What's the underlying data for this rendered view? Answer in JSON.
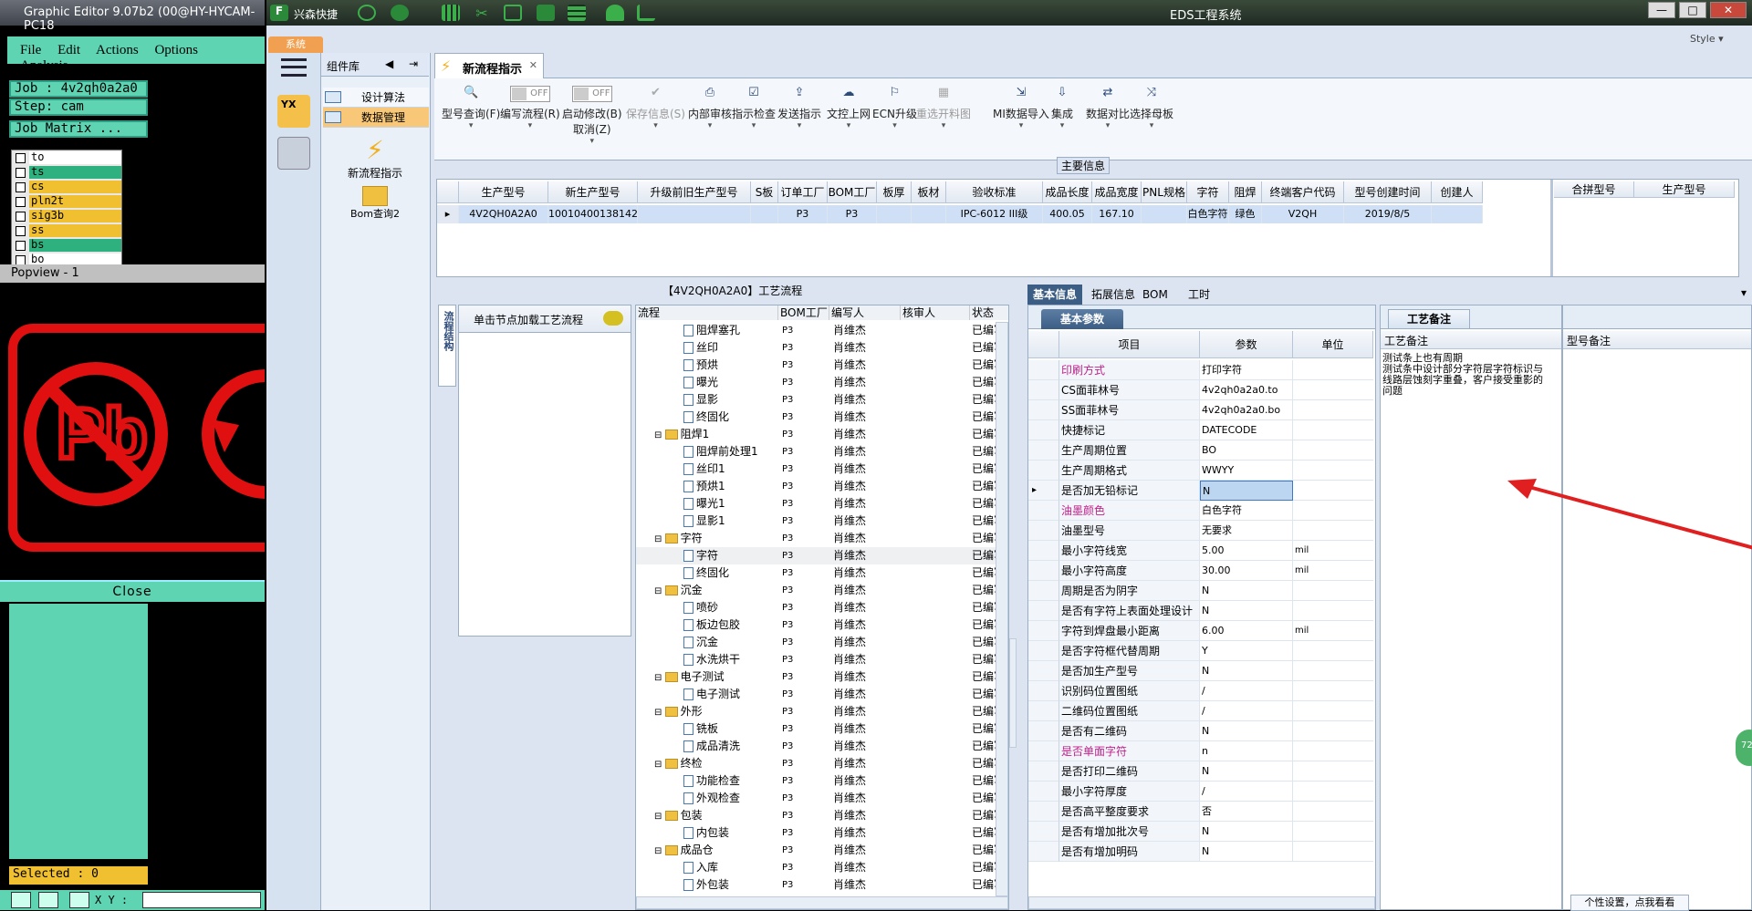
{
  "graphic_editor": {
    "title": "Graphic Editor 9.07b2 (00@HY-HYCAM-PC18",
    "menu": [
      "File",
      "Edit",
      "Actions",
      "Options",
      "Analysis"
    ],
    "job": "Job : 4v2qh0a2a0",
    "step": "Step: cam",
    "job_matrix": "Job Matrix ...",
    "layers": [
      {
        "name": "to",
        "color": "#ffffff"
      },
      {
        "name": "ts",
        "color": "#2fb07f"
      },
      {
        "name": "cs",
        "color": "#f0c030"
      },
      {
        "name": "pln2t",
        "color": "#f0c030"
      },
      {
        "name": "sig3b",
        "color": "#f0c030"
      },
      {
        "name": "ss",
        "color": "#f0c030"
      },
      {
        "name": "bs",
        "color": "#2fb07f"
      },
      {
        "name": "bo",
        "color": "#ffffff"
      }
    ],
    "popview_title": "Popview - 1",
    "close_label": "Close",
    "selected": "Selected : 0",
    "xy_label": "X Y :"
  },
  "eds": {
    "title": "EDS工程系统",
    "app_short": "兴森快捷",
    "system_tab": "系统",
    "side_menu": {
      "header": "组件库",
      "items": [
        "设计算法",
        "数据管理"
      ],
      "launchers": [
        "新流程指示",
        "Bom查询2"
      ]
    },
    "doc_tab": "新流程指示",
    "toolbar": [
      {
        "label": "型号查询(F)",
        "icon": "🔍",
        "enabled": true
      },
      {
        "label": "编写流程(R)",
        "toggle": "OFF",
        "enabled": true
      },
      {
        "label": "启动修改(B)",
        "label2": "取消(Z)",
        "toggle": "OFF",
        "enabled": true
      },
      {
        "label": "保存信息(S)",
        "icon": "✔",
        "enabled": false
      },
      {
        "label": "内部审核",
        "icon": "⎙",
        "enabled": true
      },
      {
        "label": "指示检查",
        "icon": "☑",
        "enabled": true
      },
      {
        "label": "发送指示",
        "icon": "⇪",
        "enabled": true
      },
      {
        "label": "文控上网",
        "icon": "☁",
        "enabled": true
      },
      {
        "label": "ECN升级",
        "icon": "⚐",
        "enabled": true
      },
      {
        "label": "重选开料图",
        "icon": "▦",
        "enabled": false
      },
      {
        "label": "MI数据导入",
        "icon": "⇲",
        "enabled": true
      },
      {
        "label": "集成",
        "icon": "⇩",
        "enabled": true
      },
      {
        "label": "数据对比",
        "icon": "⇄",
        "enabled": true
      },
      {
        "label": "选择母板",
        "icon": "⤨",
        "enabled": true
      }
    ],
    "main_info_label": "主要信息",
    "main_grid": {
      "headers": [
        "生产型号",
        "新生产型号",
        "升级前旧生产型号",
        "S板",
        "订单工厂",
        "BOM工厂",
        "板厚",
        "板材",
        "验收标准",
        "成品长度",
        "成品宽度",
        "PNL规格",
        "字符",
        "阻焊",
        "终端客户代码",
        "型号创建时间",
        "创建人"
      ],
      "row": [
        "4V2QH0A2A0",
        "10010400138142",
        "",
        "",
        "P3",
        "P3",
        "",
        "",
        "IPC-6012 III级",
        "400.05",
        "167.10",
        "",
        "白色字符",
        "绿色",
        "V2QH",
        "2019/8/5",
        ""
      ],
      "side_headers": [
        "合拼型号",
        "生产型号"
      ]
    },
    "process_title": "【4V2QH0A2A0】工艺流程",
    "left_vtab": "流程结构",
    "load_hint": "单击节点加载工艺流程",
    "tree_headers": [
      "流程",
      "BOM工厂",
      "编写人",
      "核审人",
      "状态"
    ],
    "tree_rows": [
      {
        "lvl": 2,
        "name": "阻焊塞孔",
        "f": "P3",
        "w": "肖维杰",
        "s": "已编写"
      },
      {
        "lvl": 2,
        "name": "丝印",
        "f": "P3",
        "w": "肖维杰",
        "s": "已编写"
      },
      {
        "lvl": 2,
        "name": "预烘",
        "f": "P3",
        "w": "肖维杰",
        "s": "已编写"
      },
      {
        "lvl": 2,
        "name": "曝光",
        "f": "P3",
        "w": "肖维杰",
        "s": "已编写"
      },
      {
        "lvl": 2,
        "name": "显影",
        "f": "P3",
        "w": "肖维杰",
        "s": "已编写"
      },
      {
        "lvl": 2,
        "name": "终固化",
        "f": "P3",
        "w": "肖维杰",
        "s": "已编写"
      },
      {
        "lvl": 1,
        "name": "阻焊1",
        "f": "P3",
        "w": "肖维杰",
        "s": "已编写"
      },
      {
        "lvl": 2,
        "name": "阻焊前处理1",
        "f": "P3",
        "w": "肖维杰",
        "s": "已编写"
      },
      {
        "lvl": 2,
        "name": "丝印1",
        "f": "P3",
        "w": "肖维杰",
        "s": "已编写"
      },
      {
        "lvl": 2,
        "name": "预烘1",
        "f": "P3",
        "w": "肖维杰",
        "s": "已编写"
      },
      {
        "lvl": 2,
        "name": "曝光1",
        "f": "P3",
        "w": "肖维杰",
        "s": "已编写"
      },
      {
        "lvl": 2,
        "name": "显影1",
        "f": "P3",
        "w": "肖维杰",
        "s": "已编写"
      },
      {
        "lvl": 1,
        "name": "字符",
        "f": "P3",
        "w": "肖维杰",
        "s": "已编写"
      },
      {
        "lvl": 2,
        "name": "字符",
        "f": "P3",
        "w": "肖维杰",
        "s": "已编写"
      },
      {
        "lvl": 2,
        "name": "终固化",
        "f": "P3",
        "w": "肖维杰",
        "s": "已编写"
      },
      {
        "lvl": 1,
        "name": "沉金",
        "f": "P3",
        "w": "肖维杰",
        "s": "已编写"
      },
      {
        "lvl": 2,
        "name": "喷砂",
        "f": "P3",
        "w": "肖维杰",
        "s": "已编写"
      },
      {
        "lvl": 2,
        "name": "板边包胶",
        "f": "P3",
        "w": "肖维杰",
        "s": "已编写"
      },
      {
        "lvl": 2,
        "name": "沉金",
        "f": "P3",
        "w": "肖维杰",
        "s": "已编写"
      },
      {
        "lvl": 2,
        "name": "水洗烘干",
        "f": "P3",
        "w": "肖维杰",
        "s": "已编写"
      },
      {
        "lvl": 1,
        "name": "电子测试",
        "f": "P3",
        "w": "肖维杰",
        "s": "已编写"
      },
      {
        "lvl": 2,
        "name": "电子测试",
        "f": "P3",
        "w": "肖维杰",
        "s": "已编写"
      },
      {
        "lvl": 1,
        "name": "外形",
        "f": "P3",
        "w": "肖维杰",
        "s": "已编写"
      },
      {
        "lvl": 2,
        "name": "铣板",
        "f": "P3",
        "w": "肖维杰",
        "s": "已编写"
      },
      {
        "lvl": 2,
        "name": "成品清洗",
        "f": "P3",
        "w": "肖维杰",
        "s": "已编写"
      },
      {
        "lvl": 1,
        "name": "终检",
        "f": "P3",
        "w": "肖维杰",
        "s": "已编写"
      },
      {
        "lvl": 2,
        "name": "功能检查",
        "f": "P3",
        "w": "肖维杰",
        "s": "已编写"
      },
      {
        "lvl": 2,
        "name": "外观检查",
        "f": "P3",
        "w": "肖维杰",
        "s": "已编写"
      },
      {
        "lvl": 1,
        "name": "包装",
        "f": "P3",
        "w": "肖维杰",
        "s": "已编写"
      },
      {
        "lvl": 2,
        "name": "内包装",
        "f": "P3",
        "w": "肖维杰",
        "s": "已编写"
      },
      {
        "lvl": 1,
        "name": "成品仓",
        "f": "P3",
        "w": "肖维杰",
        "s": "已编写"
      },
      {
        "lvl": 2,
        "name": "入库",
        "f": "P3",
        "w": "肖维杰",
        "s": "已编写"
      },
      {
        "lvl": 2,
        "name": "外包装",
        "f": "P3",
        "w": "肖维杰",
        "s": "已编写"
      }
    ],
    "info_tabs": [
      "基本信息",
      "拓展信息",
      "BOM",
      "工时"
    ],
    "basic_tab": "基本参数",
    "basic_headers": [
      "项目",
      "参数",
      "单位"
    ],
    "basic_rows": [
      {
        "k": "印刷方式",
        "v": "打印字符",
        "u": "",
        "pink": true
      },
      {
        "k": "CS面菲林号",
        "v": "4v2qh0a2a0.to",
        "u": ""
      },
      {
        "k": "SS面菲林号",
        "v": "4v2qh0a2a0.bo",
        "u": ""
      },
      {
        "k": "快捷标记",
        "v": "DATECODE",
        "u": ""
      },
      {
        "k": "生产周期位置",
        "v": "BO",
        "u": ""
      },
      {
        "k": "生产周期格式",
        "v": "WWYY",
        "u": ""
      },
      {
        "k": "是否加无铅标记",
        "v": "N",
        "u": "",
        "selected": true
      },
      {
        "k": "油墨颜色",
        "v": "白色字符",
        "u": "",
        "pink": true
      },
      {
        "k": "油墨型号",
        "v": "无要求",
        "u": ""
      },
      {
        "k": "最小字符线宽",
        "v": "5.00",
        "u": "mil"
      },
      {
        "k": "最小字符高度",
        "v": "30.00",
        "u": "mil"
      },
      {
        "k": "周期是否为阴字",
        "v": "N",
        "u": ""
      },
      {
        "k": "是否有字符上表面处理设计",
        "v": "N",
        "u": ""
      },
      {
        "k": "字符到焊盘最小距离",
        "v": "6.00",
        "u": "mil"
      },
      {
        "k": "是否字符框代替周期",
        "v": "Y",
        "u": ""
      },
      {
        "k": "是否加生产型号",
        "v": "N",
        "u": ""
      },
      {
        "k": "识别码位置图纸",
        "v": "/",
        "u": ""
      },
      {
        "k": "二维码位置图纸",
        "v": "/",
        "u": ""
      },
      {
        "k": "是否有二维码",
        "v": "N",
        "u": ""
      },
      {
        "k": "是否单面字符",
        "v": "n",
        "u": "",
        "pink": true
      },
      {
        "k": "是否打印二维码",
        "v": "N",
        "u": ""
      },
      {
        "k": "最小字符厚度",
        "v": "/",
        "u": ""
      },
      {
        "k": "是否高平整度要求",
        "v": "否",
        "u": ""
      },
      {
        "k": "是否有增加批次号",
        "v": "N",
        "u": ""
      },
      {
        "k": "是否有增加明码",
        "v": "N",
        "u": ""
      }
    ],
    "remarks": {
      "tab": "工艺备注",
      "col1": "工艺备注",
      "col2": "型号备注",
      "text": "测试条上也有周期\n测试条中设计部分字符层字符标识与线路层蚀刻字重叠，客户接受重影的问题",
      "settings_btn": "个性设置，点我看看"
    },
    "side_badge": "72"
  }
}
